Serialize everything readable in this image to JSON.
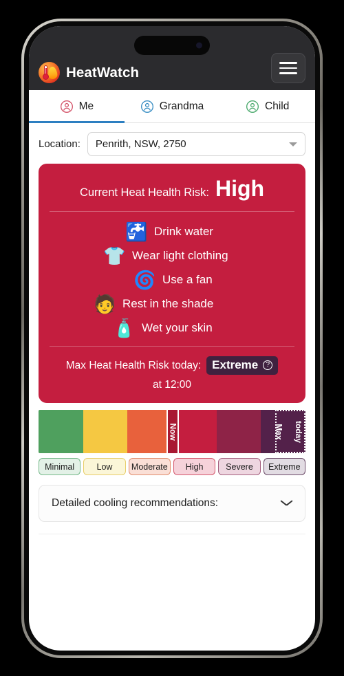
{
  "header": {
    "app_title": "HeatWatch",
    "logo_icon": "thermometer-flame-logo",
    "menu_icon": "hamburger-menu-icon",
    "background_color": "#2b2b2e"
  },
  "tabs": [
    {
      "label": "Me",
      "icon": "person-circle-icon",
      "color": "#d4566b",
      "active": true
    },
    {
      "label": "Grandma",
      "icon": "person-circle-icon",
      "color": "#3a8fc4",
      "active": false
    },
    {
      "label": "Child",
      "icon": "person-circle-icon",
      "color": "#4aa96c",
      "active": false
    }
  ],
  "location": {
    "label": "Location:",
    "value": "Penrith, NSW, 2750",
    "caret_icon": "caret-down-icon"
  },
  "risk_card": {
    "background_color": "#c41e3f",
    "headline_label": "Current Heat Health Risk:",
    "headline_value": "High",
    "advice": [
      {
        "emoji": "🚰",
        "icon_name": "water-bottle-icon",
        "text": "Drink water"
      },
      {
        "emoji": "👕",
        "icon_name": "tshirt-icon",
        "text": "Wear light clothing"
      },
      {
        "emoji": "🌀",
        "icon_name": "fan-icon",
        "text": "Use a fan"
      },
      {
        "emoji": "🧑",
        "icon_name": "person-resting-icon",
        "text": "Rest in the shade"
      },
      {
        "emoji": "🧴",
        "icon_name": "spray-bottle-icon",
        "text": "Wet your skin"
      }
    ],
    "max_risk_label": "Max Heat Health Risk today:",
    "max_risk_value": "Extreme",
    "max_risk_help_icon": "help-circle-icon",
    "max_risk_time": "at 12:00",
    "badge_color": "#40213f"
  },
  "scale": {
    "segments": [
      {
        "name": "Minimal",
        "color": "#4fa05e"
      },
      {
        "name": "Low",
        "color": "#f5c842"
      },
      {
        "name": "Moderate",
        "color": "#e8613c"
      },
      {
        "name": "High",
        "color": "#c41e3f"
      },
      {
        "name": "Severe",
        "color": "#8e2347"
      },
      {
        "name": "Extreme",
        "color": "#53214a"
      }
    ],
    "now_marker": {
      "label": "Now",
      "position_percent": 48
    },
    "max_marker": {
      "label_line1": "Max",
      "label_line2": "today",
      "position_percent": 100
    }
  },
  "legend": [
    {
      "label": "Minimal",
      "fill": "#e3f1e7",
      "border": "#76b98a"
    },
    {
      "label": "Low",
      "fill": "#fbf6d8",
      "border": "#e8ce6a"
    },
    {
      "label": "Moderate",
      "fill": "#fadfd6",
      "border": "#e18e6f"
    },
    {
      "label": "High",
      "fill": "#f6d2da",
      "border": "#d4566b"
    },
    {
      "label": "Severe",
      "fill": "#eed6e0",
      "border": "#a45f7e"
    },
    {
      "label": "Extreme",
      "fill": "#e2dce3",
      "border": "#6b4a68"
    }
  ],
  "detail": {
    "accordion_label": "Detailed cooling recommendations:",
    "chevron_icon": "chevron-down-icon"
  }
}
